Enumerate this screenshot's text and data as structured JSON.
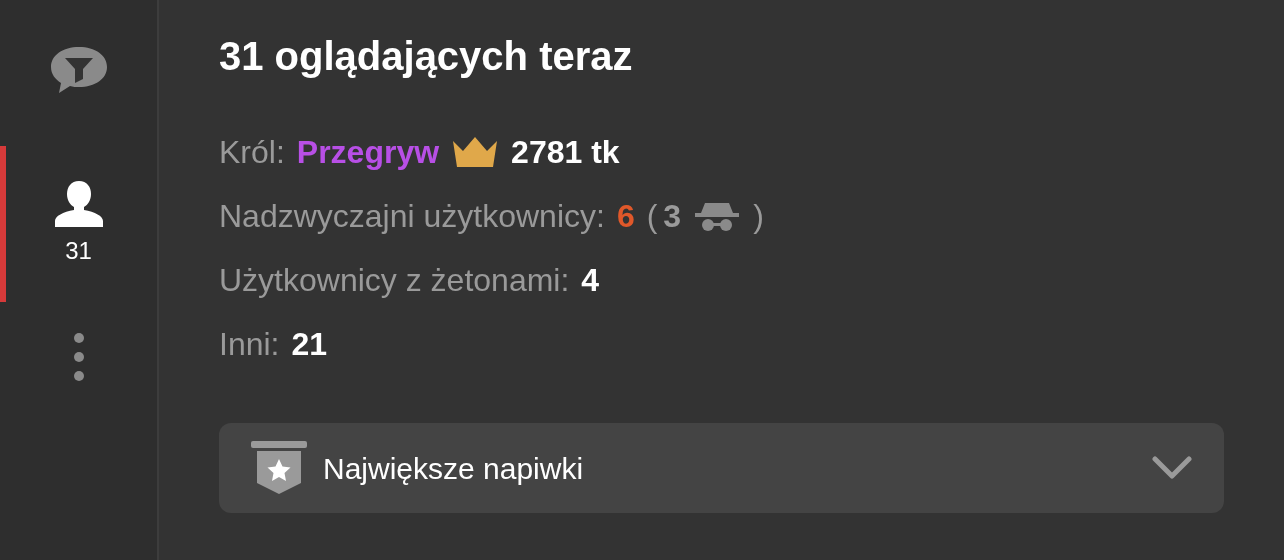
{
  "sidebar": {
    "items": [
      {
        "kind": "chat",
        "selected": false
      },
      {
        "kind": "users",
        "selected": true,
        "count": "31"
      },
      {
        "kind": "more",
        "selected": false
      }
    ]
  },
  "title": "31 oglądających teraz",
  "king": {
    "label": "Król:",
    "name": "Przegryw",
    "color": "#b84fe6",
    "tokens": "2781 tk"
  },
  "stats": [
    {
      "kind": "special",
      "label": "Nadzwyczajni użytkownicy:",
      "value": "6",
      "open": "(",
      "hidden": "3",
      "close": ")"
    },
    {
      "kind": "plain",
      "label": "Użytkownicy z żetonami:",
      "value": "4"
    },
    {
      "kind": "plain",
      "label": "Inni:",
      "value": "21"
    }
  ],
  "dropdown": {
    "label": "Największe napiwki",
    "expanded": false
  }
}
